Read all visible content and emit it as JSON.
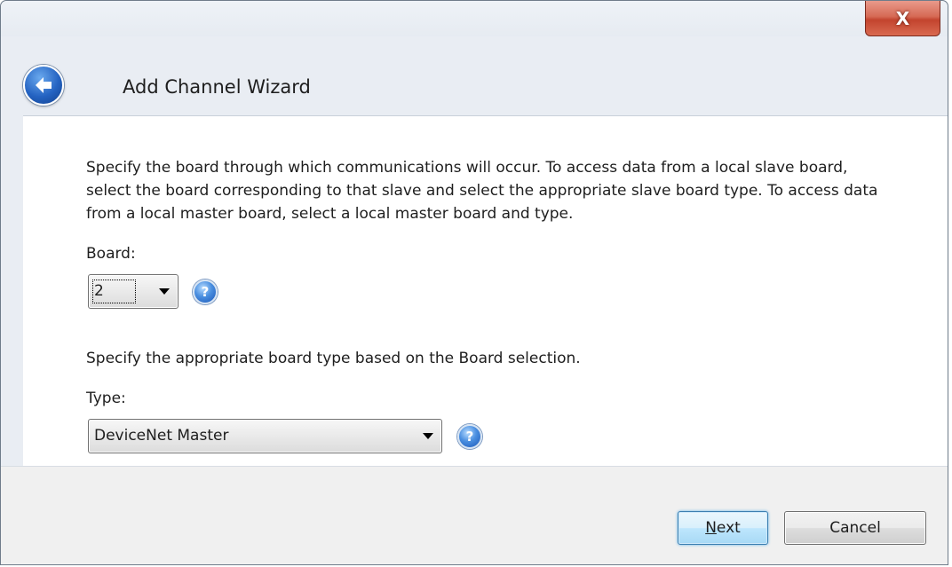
{
  "window": {
    "close_glyph": "X"
  },
  "header": {
    "back_icon": "back-arrow-icon",
    "title": "Add Channel Wizard"
  },
  "content": {
    "description": "Specify the board through which communications will occur. To access data from a local slave board, select the board corresponding to that slave and select the appropriate slave board type. To access data from a local master board, select a local master board and type.",
    "board": {
      "label": "Board:",
      "selected": "2"
    },
    "type_description": "Specify the appropriate board type based on the Board selection.",
    "type": {
      "label": "Type:",
      "selected": "DeviceNet Master"
    },
    "help_glyph": "?"
  },
  "footer": {
    "next_label": "Next",
    "cancel_label": "Cancel"
  },
  "colors": {
    "close_button": "#c3442e",
    "back_button": "#2463c2",
    "next_border": "#3c7fb1"
  }
}
